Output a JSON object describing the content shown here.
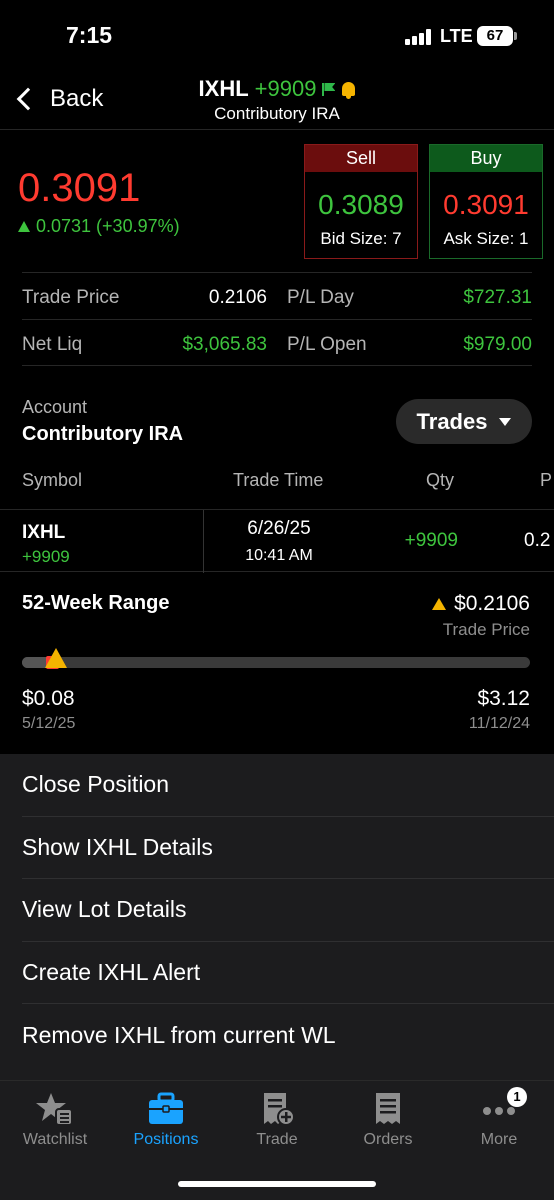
{
  "status_bar": {
    "time": "7:15",
    "network": "LTE",
    "battery": "67"
  },
  "nav": {
    "back_label": "Back",
    "symbol": "IXHL",
    "position_qty": "+9909",
    "account": "Contributory IRA"
  },
  "quote": {
    "last": "0.3091",
    "change": "0.0731 (+30.97%)",
    "sell": {
      "label": "Sell",
      "price": "0.3089",
      "size": "Bid Size: 7"
    },
    "buy": {
      "label": "Buy",
      "price": "0.3091",
      "size": "Ask Size: 1"
    }
  },
  "stats": {
    "trade_price_label": "Trade Price",
    "trade_price": "0.2106",
    "pl_day_label": "P/L Day",
    "pl_day": "$727.31",
    "net_liq_label": "Net Liq",
    "net_liq": "$3,065.83",
    "pl_open_label": "P/L Open",
    "pl_open": "$979.00"
  },
  "account": {
    "label": "Account",
    "name": "Contributory IRA",
    "view_selector": "Trades"
  },
  "trades_table": {
    "columns": [
      "Symbol",
      "Trade Time",
      "Qty",
      "P"
    ],
    "rows": [
      {
        "symbol": "IXHL",
        "symbol_qty": "+9909",
        "date": "6/26/25",
        "time": "10:41 AM",
        "qty": "+9909",
        "price": "0.2"
      }
    ]
  },
  "range": {
    "title": "52-Week Range",
    "trade_price": "$0.2106",
    "trade_price_label": "Trade Price",
    "low": "$0.08",
    "low_date": "5/12/25",
    "high": "$3.12",
    "high_date": "11/12/24",
    "low_value": 0.08,
    "high_value": 3.12,
    "last_value": 0.3091,
    "trade_value": 0.2106
  },
  "menu": {
    "items": [
      "Close Position",
      "Show IXHL Details",
      "View Lot Details",
      "Create IXHL Alert",
      "Remove IXHL from current WL"
    ]
  },
  "tabbar": {
    "items": [
      {
        "label": "Watchlist",
        "icon": "star-list-icon"
      },
      {
        "label": "Positions",
        "icon": "briefcase-icon"
      },
      {
        "label": "Trade",
        "icon": "receipt-plus-icon"
      },
      {
        "label": "Orders",
        "icon": "receipt-icon"
      },
      {
        "label": "More",
        "icon": "more-dots-icon"
      }
    ],
    "active": "Positions",
    "more_badge": "1"
  },
  "colors": {
    "up": "#3ec43e",
    "down": "#ff3b30",
    "accent": "#1aa3ff",
    "warn": "#f5b400"
  }
}
